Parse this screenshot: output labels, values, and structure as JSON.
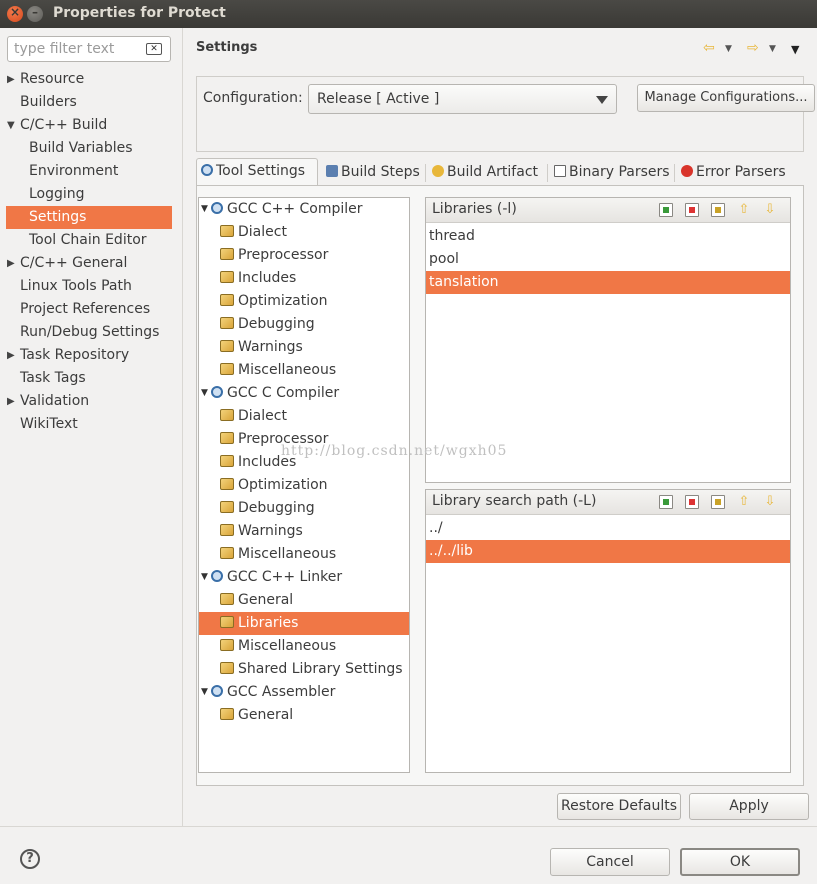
{
  "window": {
    "title": "Properties for Protect"
  },
  "filter": {
    "placeholder": "type filter text"
  },
  "nav": [
    {
      "label": "Resource",
      "expandable": true
    },
    {
      "label": "Builders"
    },
    {
      "label": "C/C++ Build",
      "expanded": true
    },
    {
      "label": "Build Variables"
    },
    {
      "label": "Environment"
    },
    {
      "label": "Logging"
    },
    {
      "label": "Settings",
      "selected": true
    },
    {
      "label": "Tool Chain Editor"
    },
    {
      "label": "C/C++ General",
      "expandable": true
    },
    {
      "label": "Linux Tools Path"
    },
    {
      "label": "Project References"
    },
    {
      "label": "Run/Debug Settings"
    },
    {
      "label": "Task Repository",
      "expandable": true
    },
    {
      "label": "Task Tags"
    },
    {
      "label": "Validation",
      "expandable": true
    },
    {
      "label": "WikiText"
    }
  ],
  "page": {
    "title": "Settings"
  },
  "config": {
    "label": "Configuration:",
    "value": "Release  [ Active ]",
    "manage_button": "Manage Configurations..."
  },
  "tabs": [
    "Tool Settings",
    "Build Steps",
    "Build Artifact",
    "Binary Parsers",
    "Error Parsers"
  ],
  "tree": [
    {
      "label": "GCC C++ Compiler",
      "group": true
    },
    {
      "label": "Dialect"
    },
    {
      "label": "Preprocessor"
    },
    {
      "label": "Includes"
    },
    {
      "label": "Optimization"
    },
    {
      "label": "Debugging"
    },
    {
      "label": "Warnings"
    },
    {
      "label": "Miscellaneous"
    },
    {
      "label": "GCC C Compiler",
      "group": true
    },
    {
      "label": "Dialect"
    },
    {
      "label": "Preprocessor"
    },
    {
      "label": "Includes"
    },
    {
      "label": "Optimization"
    },
    {
      "label": "Debugging"
    },
    {
      "label": "Warnings"
    },
    {
      "label": "Miscellaneous"
    },
    {
      "label": "GCC C++ Linker",
      "group": true
    },
    {
      "label": "General"
    },
    {
      "label": "Libraries",
      "selected": true
    },
    {
      "label": "Miscellaneous"
    },
    {
      "label": "Shared Library Settings"
    },
    {
      "label": "GCC Assembler",
      "group": true
    },
    {
      "label": "General"
    }
  ],
  "libraries": {
    "title": "Libraries (-l)",
    "items": [
      "thread",
      "pool",
      "tanslation"
    ],
    "selected_index": 2
  },
  "search_path": {
    "title": "Library search path (-L)",
    "items": [
      "../",
      "../../lib"
    ],
    "selected_index": 1
  },
  "watermark": "http://blog.csdn.net/wgxh05",
  "buttons": {
    "restore": "Restore Defaults",
    "apply": "Apply",
    "cancel": "Cancel",
    "ok": "OK"
  },
  "colors": {
    "selection": "#f07746",
    "titlebar": "#3c3b37"
  }
}
